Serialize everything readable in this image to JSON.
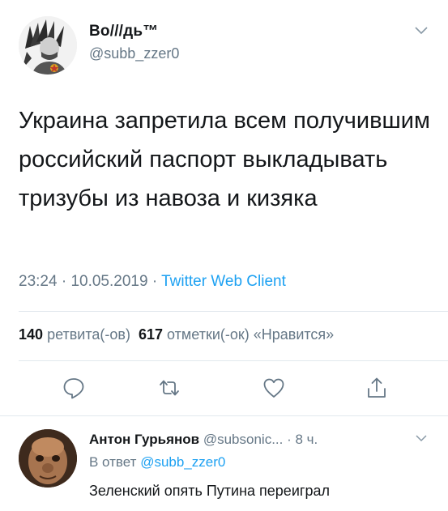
{
  "tweet": {
    "author": {
      "display_name": "Во///дь™",
      "handle": "@subb_zzer0"
    },
    "text": "Украина запретила всем получившим российский паспорт выкладывать тризубы из навоза и кизяка",
    "time": "23:24",
    "date": "10.05.2019",
    "separator": "·",
    "client": "Twitter Web Client",
    "retweets_count": "140",
    "retweets_label": "ретвита(-ов)",
    "likes_count": "617",
    "likes_label": "отметки(-ок) «Нравится»"
  },
  "actions": [
    {
      "icon": "reply-icon"
    },
    {
      "icon": "retweet-icon"
    },
    {
      "icon": "like-icon"
    },
    {
      "icon": "share-icon"
    }
  ],
  "reply": {
    "display_name": "Антон Гурьянов",
    "handle": "@subsonic...",
    "time": "· 8 ч.",
    "reply_prefix": "В ответ",
    "reply_to": "@subb_zzer0",
    "text": "Зеленский опять Путина переиграл"
  },
  "colors": {
    "text": "#14171a",
    "secondary": "#657786",
    "accent": "#1da1f2",
    "divider": "#e1e8ed"
  }
}
